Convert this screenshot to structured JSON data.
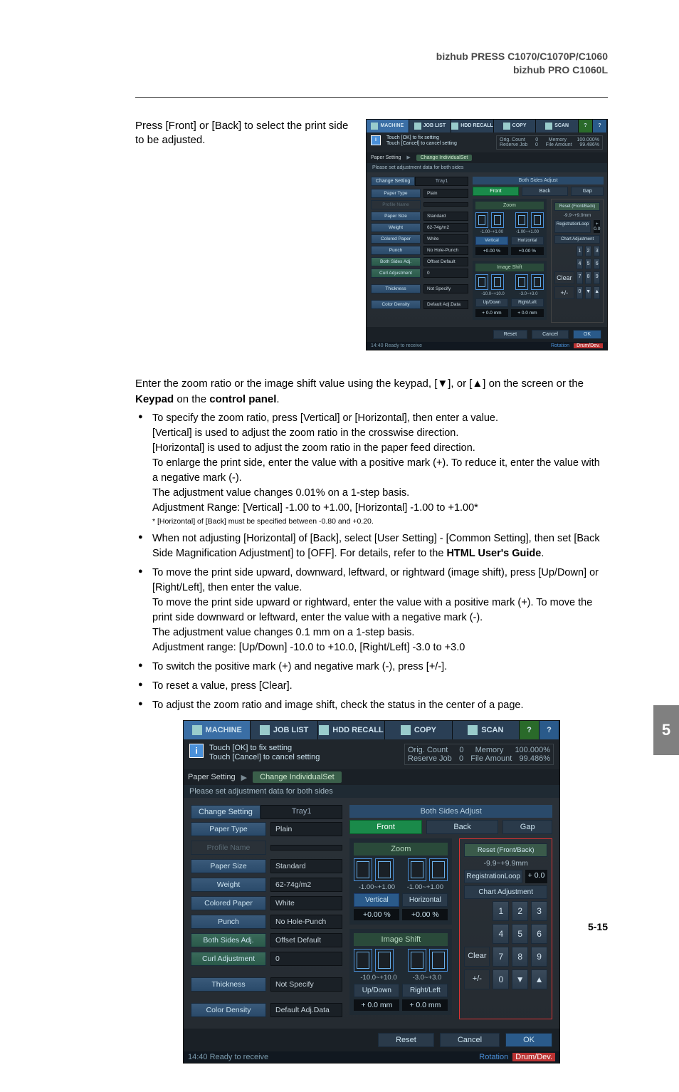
{
  "header": {
    "line1": "bizhub PRESS C1070/C1070P/C1060",
    "line2": "bizhub PRO C1060L"
  },
  "intro": "Press [Front] or [Back] to select the print side to be adjusted.",
  "para_main_pre": "Enter the zoom ratio or the image shift value using the keypad, [▼], or [▲] on the screen or the ",
  "para_main_b1": "Keypad",
  "para_main_mid": " on the ",
  "para_main_b2": "control panel",
  "para_main_post": ".",
  "bullets": {
    "b1": "To specify the zoom ratio, press [Vertical] or [Horizontal], then enter a value.\n[Vertical] is used to adjust the zoom ratio in the crosswise direction.\n[Horizontal] is used to adjust the zoom ratio in the paper feed direction.\nTo enlarge the print side, enter the value with a positive mark (+). To reduce it, enter the value with a negative mark (-).\nThe adjustment value changes 0.01% on a 1-step basis.\nAdjustment Range: [Vertical] -1.00 to +1.00, [Horizontal] -1.00 to +1.00*",
    "b1_foot": "* [Horizontal] of [Back] must be specified between -0.80 and +0.20.",
    "b2_pre": "When not adjusting [Horizontal] of [Back], select [User Setting] - [Common Setting], then set [Back Side Magnification Adjustment] to [OFF]. For details, refer to the ",
    "b2_b": "HTML User's Guide",
    "b2_post": ".",
    "b3": "To move the print side upward, downward, leftward, or rightward (image shift), press [Up/Down] or [Right/Left], then enter the value.\nTo move the print side upward or rightward, enter the value with a positive mark (+). To move the print side downward or leftward, enter the value with a negative mark (-).\nThe adjustment value changes 0.1 mm on a 1-step basis.\nAdjustment range: [Up/Down] -10.0 to +10.0, [Right/Left] -3.0 to +3.0",
    "b4": "To switch the positive mark (+) and negative mark (-), press [+/-].",
    "b5": "To reset a value, press [Clear].",
    "b6": "To adjust the zoom ratio and image shift, check the status in the center of a page."
  },
  "screenshot": {
    "nav": {
      "machine": "MACHINE",
      "joblist": "JOB LIST",
      "hdd": "HDD RECALL",
      "copy": "COPY",
      "scan": "SCAN"
    },
    "info": {
      "l1": "Touch [OK] to fix setting",
      "l2": "Touch [Cancel] to cancel setting"
    },
    "status": {
      "orig": "Orig. Count",
      "orig_v": "0",
      "mem": "Memory",
      "mem_v": "100.000%",
      "res": "Reserve Job",
      "res_v": "0",
      "file": "File Amount",
      "file_v": "99.486%"
    },
    "crumb1": "Paper Setting",
    "crumb2": "Change IndividualSet",
    "subtitle": "Please set adjustment data for both sides",
    "leftpanel": {
      "change": "Change Setting",
      "tray": "Tray1",
      "rows": [
        {
          "k": "Paper Type",
          "v": "Plain"
        },
        {
          "k": "Profile Name",
          "v": "",
          "dis": true
        },
        {
          "k": "Paper Size",
          "v": "Standard"
        },
        {
          "k": "Weight",
          "v": "62-74g/m2"
        },
        {
          "k": "Colored Paper",
          "v": "White"
        },
        {
          "k": "Punch",
          "v": "No Hole-Punch"
        },
        {
          "k": "Both Sides Adj.",
          "v": "Offset Default",
          "alt": true
        },
        {
          "k": "Curl Adjustment",
          "v": "0",
          "alt": true
        },
        {
          "k": "Thickness",
          "v": "Not Specify"
        },
        {
          "k": "Color Density",
          "v": "Default Adj.Data"
        }
      ]
    },
    "rightpanel": {
      "title": "Both Sides Adjust",
      "front": "Front",
      "back": "Back",
      "gap": "Gap",
      "zoom": {
        "title": "Zoom",
        "rangeV": "-1.00~+1.00",
        "rangeH": "-1.00~+1.00",
        "vert": "Vertical",
        "horz": "Horizontal",
        "valV": "+0.00 %",
        "valH": "+0.00 %"
      },
      "shift": {
        "title": "Image Shift",
        "rangeU": "-10.0~+10.0",
        "rangeR": "-3.0~+3.0",
        "ud": "Up/Down",
        "rl": "Right/Left",
        "valU": "+ 0.0 mm",
        "valR": "+ 0.0 mm"
      },
      "pad": {
        "resetfb": "Reset (Front/Back)",
        "range": "-9.9~+9.9mm",
        "regloop": "RegistrationLoop",
        "regval": "+ 0.0",
        "chartadj": "Chart Adjustment",
        "clear": "Clear",
        "pm": "+/-",
        "down": "▼",
        "up": "▲",
        "keys": [
          "1",
          "2",
          "3",
          "4",
          "5",
          "6",
          "7",
          "8",
          "9",
          "0"
        ]
      }
    },
    "bottom": {
      "reset": "Reset",
      "cancel": "Cancel",
      "ok": "OK"
    },
    "statusline": {
      "time": "14:40",
      "ready": "Ready to receive",
      "rotation": "Rotation",
      "drum": "Drum/Dev."
    }
  },
  "side": "5",
  "pagenum": "5-15"
}
